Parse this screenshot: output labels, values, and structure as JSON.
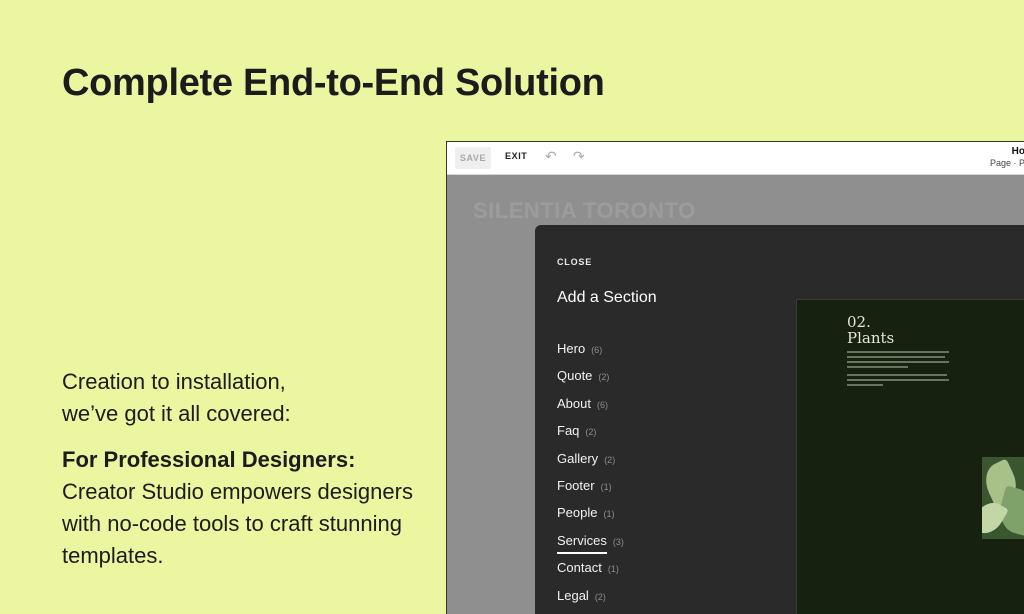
{
  "headline": "Complete End-to-End Solution",
  "intro": {
    "line1": "Creation to installation,",
    "line2": "we’ve got it all covered:"
  },
  "designers": {
    "heading": "For Professional Designers:",
    "body": "Creator Studio empowers designers with no-code tools to craft stunning templates."
  },
  "app": {
    "toolbar": {
      "save_label": "SAVE",
      "exit_label": "EXIT",
      "page_title": "Ho",
      "page_subtitle": "Page · P"
    },
    "site_logo": "SILENTIA TORONTO",
    "panel": {
      "close_label": "CLOSE",
      "title": "Add a Section",
      "items": [
        {
          "label": "Hero",
          "count": "(6)"
        },
        {
          "label": "Quote",
          "count": "(2)"
        },
        {
          "label": "About",
          "count": "(6)"
        },
        {
          "label": "Faq",
          "count": "(2)"
        },
        {
          "label": "Gallery",
          "count": "(2)"
        },
        {
          "label": "Footer",
          "count": "(1)"
        },
        {
          "label": "People",
          "count": "(1)"
        },
        {
          "label": "Services",
          "count": "(3)"
        },
        {
          "label": "Contact",
          "count": "(1)"
        },
        {
          "label": "Legal",
          "count": "(2)"
        }
      ],
      "active_item": "Services"
    },
    "preview": {
      "number": "02.",
      "name": "Plants"
    }
  },
  "colors": {
    "page_background": "#ecf59f",
    "panel_background": "#2a2a2a",
    "preview_background": "#17210f"
  }
}
